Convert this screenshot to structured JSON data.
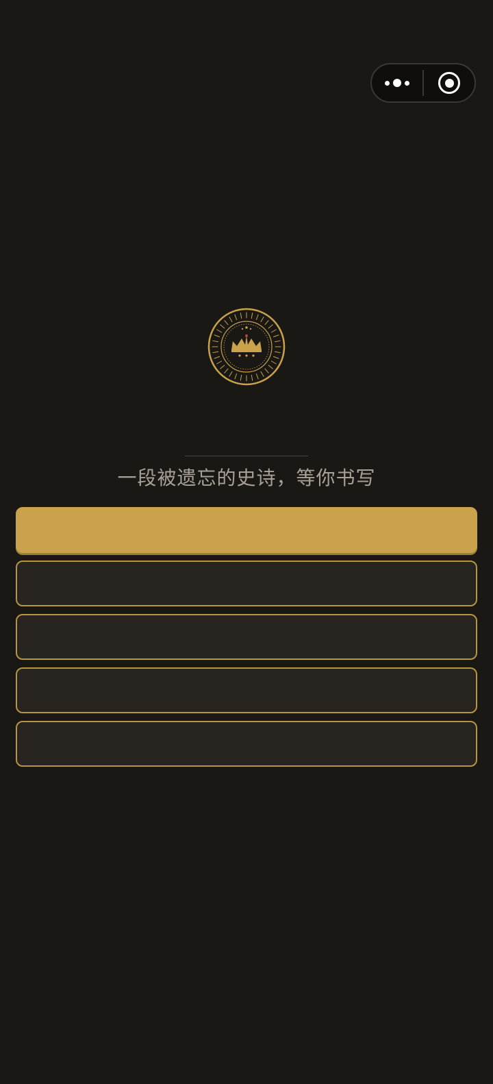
{
  "capsule": {
    "more_icon": "more-dots-icon",
    "close_icon": "target-circle-icon"
  },
  "emblem": {
    "icon": "crown-medallion-icon",
    "color": "#c9a24b"
  },
  "tagline": "一段被遗忘的史诗，等你书写",
  "menu": {
    "buttons": [
      {
        "label": ""
      },
      {
        "label": ""
      },
      {
        "label": ""
      },
      {
        "label": ""
      },
      {
        "label": ""
      }
    ]
  },
  "colors": {
    "background": "#1a1815",
    "accent_gold": "#c9a24b",
    "button_dark": "#28241f"
  }
}
